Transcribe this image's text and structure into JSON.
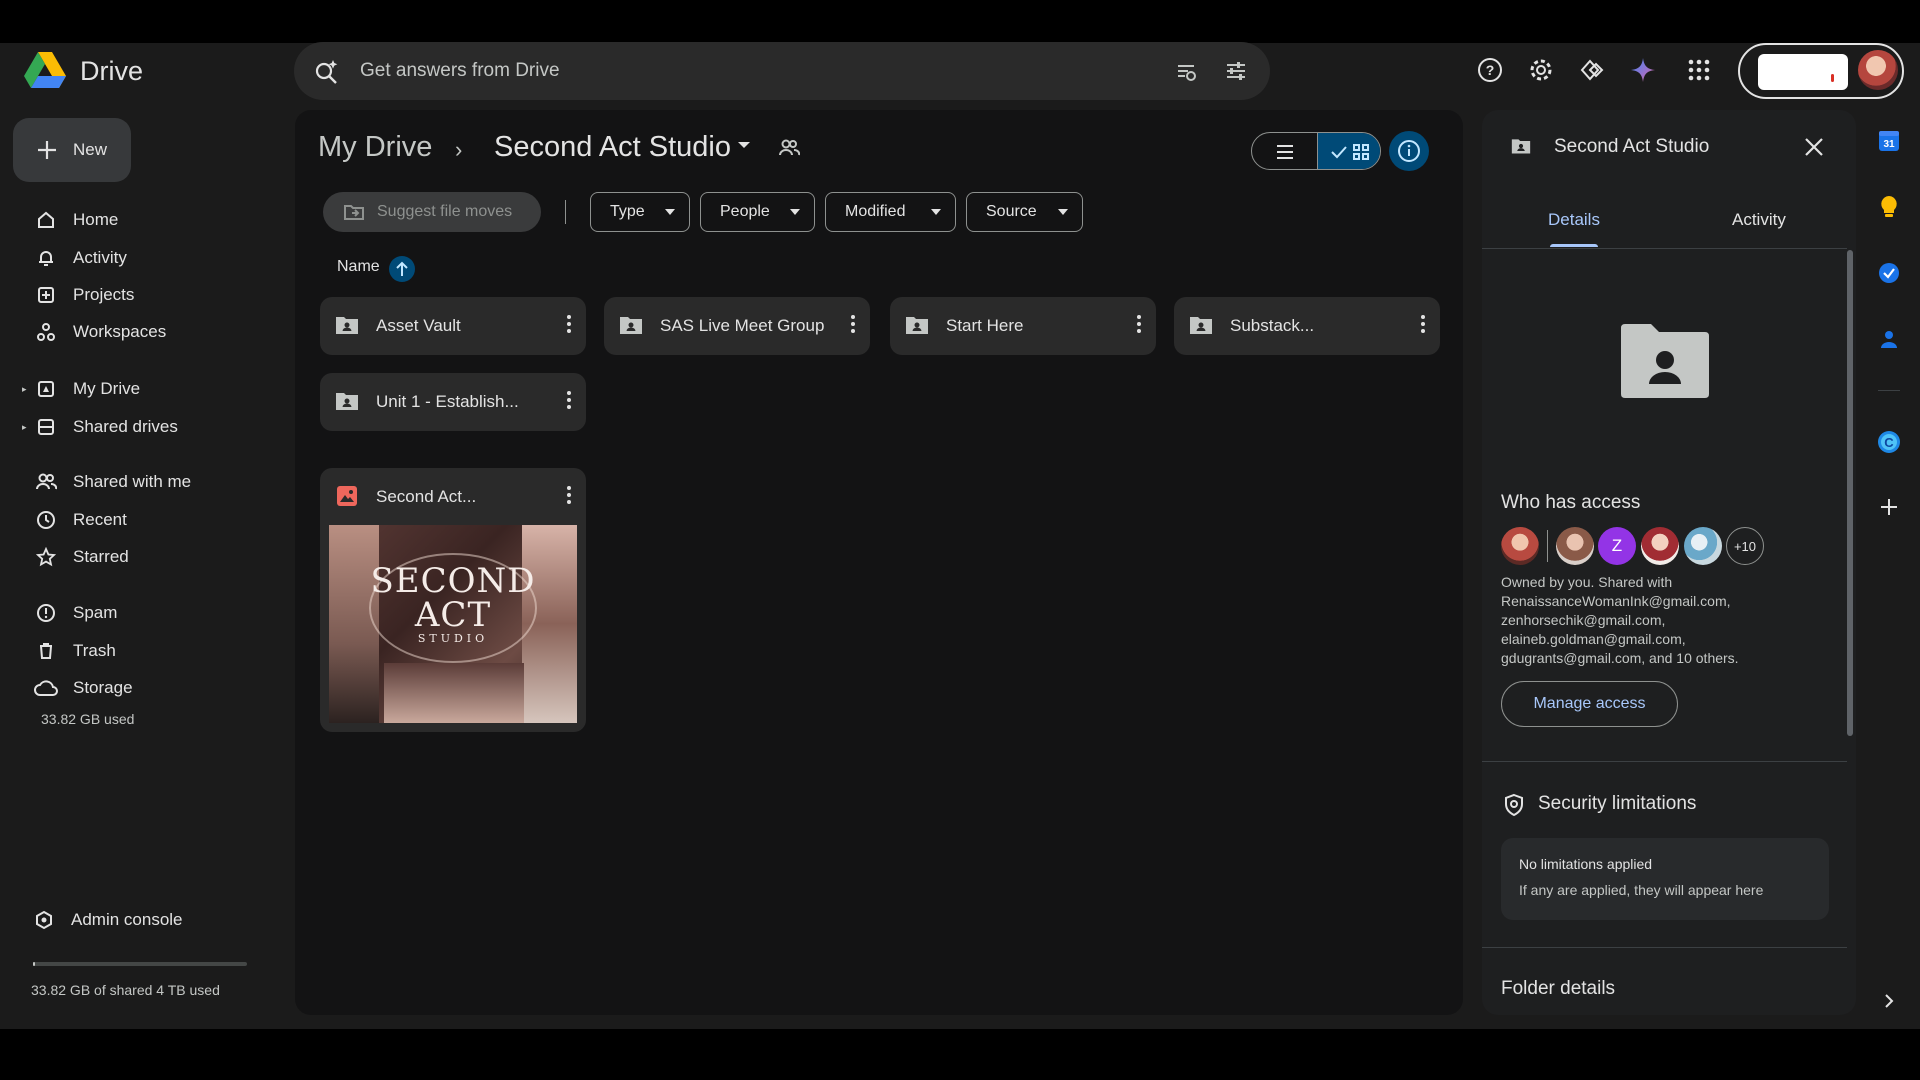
{
  "app": {
    "name": "Drive"
  },
  "search": {
    "placeholder": "Get answers from Drive"
  },
  "nav": {
    "new_label": "New",
    "items": [
      {
        "label": "Home"
      },
      {
        "label": "Activity"
      },
      {
        "label": "Projects"
      },
      {
        "label": "Workspaces"
      },
      {
        "label": "My Drive"
      },
      {
        "label": "Shared drives"
      },
      {
        "label": "Shared with me"
      },
      {
        "label": "Recent"
      },
      {
        "label": "Starred"
      },
      {
        "label": "Spam"
      },
      {
        "label": "Trash"
      },
      {
        "label": "Storage"
      }
    ],
    "storage_used": "33.82 GB used",
    "admin_console": "Admin console",
    "storage_total": "33.82 GB of shared 4 TB used",
    "storage_fraction": 0.01
  },
  "breadcrumb": {
    "root": "My Drive",
    "separator": "›",
    "current": "Second Act Studio"
  },
  "filters": {
    "suggest": "Suggest file moves",
    "chips": [
      "Type",
      "People",
      "Modified",
      "Source"
    ]
  },
  "sort": {
    "label": "Name"
  },
  "folders": [
    {
      "name": "Asset Vault"
    },
    {
      "name": "SAS Live Meet Group"
    },
    {
      "name": "Start Here"
    },
    {
      "name": "Substack..."
    },
    {
      "name": "Unit 1 - Establish..."
    }
  ],
  "file": {
    "name": "Second Act...",
    "thumb_line1": "SECOND",
    "thumb_line2": "ACT",
    "thumb_line3": "STUDIO"
  },
  "details": {
    "title": "Second Act Studio",
    "tabs": [
      "Details",
      "Activity"
    ],
    "who_has_access": "Who has access",
    "access_avatar_z": "Z",
    "more_count": "+10",
    "owned_text": "Owned by you. Shared with RenaissanceWomanInk@gmail.com, zenhorsechik@gmail.com, elaineb.goldman@gmail.com, gdugrants@gmail.com, and 10 others.",
    "manage_access": "Manage access",
    "security_title": "Security limitations",
    "no_limitations": "No limitations applied",
    "limitations_hint": "If any are applied, they will appear here",
    "folder_details": "Folder details"
  },
  "side_panel": {
    "calendar_day": "31"
  },
  "colors": {
    "accent": "#a8c7fa",
    "selected": "#004a77",
    "background": "#131314"
  }
}
